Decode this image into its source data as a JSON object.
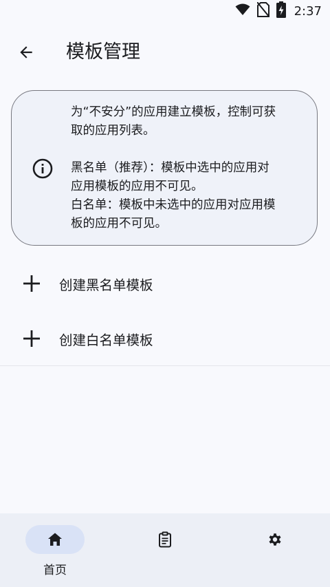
{
  "status_bar": {
    "time": "2:37",
    "icons": [
      "wifi-icon",
      "no-sim-icon",
      "battery-charging-icon"
    ]
  },
  "app_bar": {
    "back_icon": "arrow-left-icon",
    "title": "模板管理"
  },
  "info_card": {
    "icon": "info-icon",
    "paragraph_1_line_1": "为“不安分”的应用建立模板，控制可获",
    "paragraph_1_line_2": "取的应用列表。",
    "paragraph_2_line_1": "黑名单（推荐）：模板中选中的应用对",
    "paragraph_2_line_2": "应用模板的应用不可见。",
    "paragraph_3_line_1": "白名单：模板中未选中的应用对应用模",
    "paragraph_3_line_2": "板的应用不可见。"
  },
  "actions": [
    {
      "icon": "plus-icon",
      "label": "创建黑名单模板"
    },
    {
      "icon": "plus-icon",
      "label": "创建白名单模板"
    }
  ],
  "bottom_nav": {
    "items": [
      {
        "icon": "home-icon",
        "label": "首页",
        "selected": true
      },
      {
        "icon": "clipboard-list-icon",
        "label": "",
        "selected": false
      },
      {
        "icon": "gear-icon",
        "label": "",
        "selected": false
      }
    ]
  },
  "colors": {
    "background": "#f8f9fd",
    "card_background": "#eff2f9",
    "nav_background": "#eceff6",
    "nav_selected_pill": "#d9e2f6",
    "text": "#1b1c1f"
  }
}
